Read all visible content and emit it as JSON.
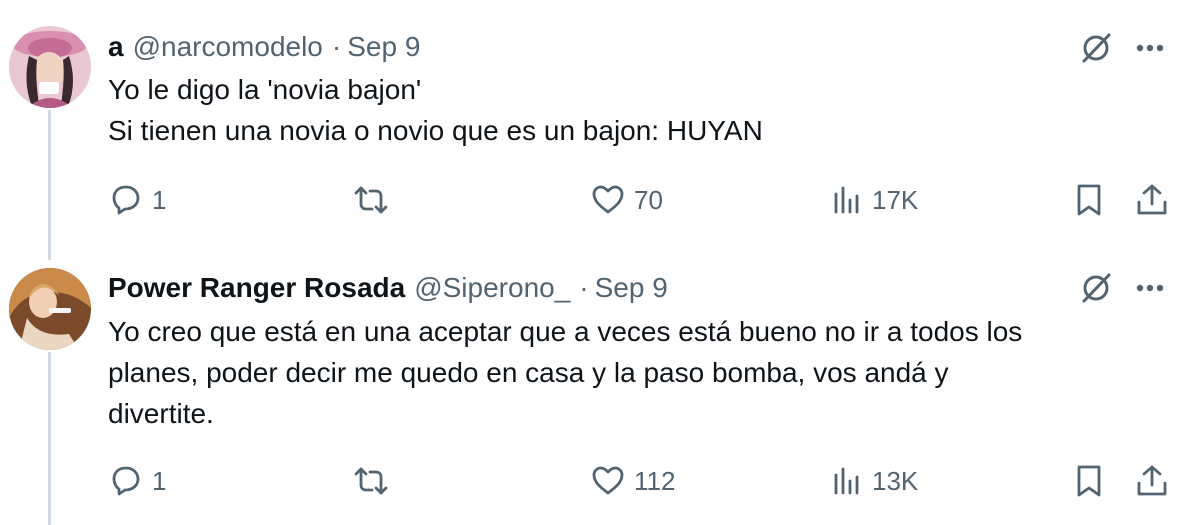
{
  "tweets": [
    {
      "name": "a",
      "handle": "@narcomodelo",
      "separator": "·",
      "date": "Sep 9",
      "text": "Yo le digo la 'novia bajon'\nSi tienen una novia o novio que es un bajon: HUYAN",
      "replies": "1",
      "likes": "70",
      "views": "17K"
    },
    {
      "name": "Power Ranger Rosada",
      "handle": "@Siperono_",
      "separator": "·",
      "date": "Sep 9",
      "text": "Yo creo que está en una aceptar que a veces está bueno no ir a todos los\nplanes, poder decir me quedo en casa y la paso bomba, vos andá y\ndivertite.",
      "replies": "1",
      "likes": "112",
      "views": "13K"
    }
  ],
  "icons": [
    "grok-icon",
    "more-icon",
    "reply-icon",
    "retweet-icon",
    "like-icon",
    "views-icon",
    "bookmark-icon",
    "share-icon"
  ],
  "colors": {
    "text": "#0f1419",
    "secondary": "#536471",
    "thread_line": "#cfd9de"
  }
}
